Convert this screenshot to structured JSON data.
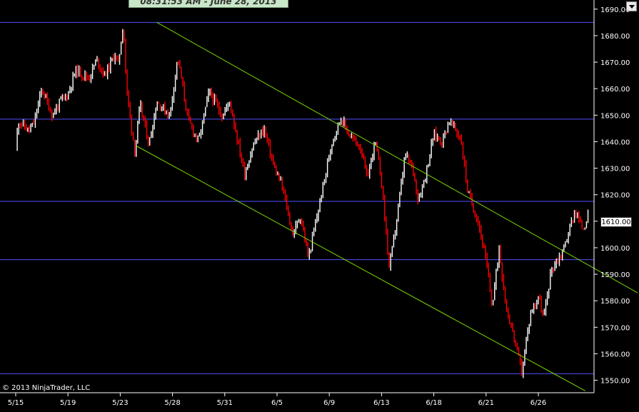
{
  "header": {
    "timestamp": "08:31:53 AM - June 28, 2013"
  },
  "footer": {
    "copyright": "© 2013 NinjaTrader, LLC"
  },
  "price_marker": {
    "label": "1610.00",
    "value": 1610
  },
  "colors": {
    "background": "#000000",
    "up_bar": "#ffffff",
    "down_bar": "#ff0000",
    "horizontal_lines": "#5050ff",
    "trend_channel": "#7cd600",
    "axis": "#ffffff"
  },
  "chart_data": {
    "type": "candlestick",
    "title": "",
    "xlabel": "",
    "ylabel": "",
    "ylim": [
      1546,
      1692
    ],
    "y_ticks": [
      1550,
      1560,
      1570,
      1580,
      1590,
      1600,
      1610,
      1620,
      1630,
      1640,
      1650,
      1660,
      1670,
      1680,
      1690
    ],
    "y_tick_labels": [
      "1550.00",
      "1560.00",
      "1570.00",
      "1580.00",
      "1590.00",
      "1600.00",
      "1610.00",
      "1620.00",
      "1630.00",
      "1640.00",
      "1650.00",
      "1660.00",
      "1670.00",
      "1680.00",
      "1690.00"
    ],
    "x_ticks": [
      "5/15",
      "5/19",
      "5/23",
      "5/28",
      "5/31",
      "6/5",
      "6/9",
      "6/13",
      "6/18",
      "6/21",
      "6/26"
    ],
    "grid": false,
    "horizontal_levels": [
      1685,
      1648.5,
      1617.5,
      1595.5,
      1552.5
    ],
    "trend_channel": [
      {
        "name": "upper",
        "from": {
          "x": 2.7,
          "y": 1685
        },
        "to": {
          "x": 11.9,
          "y": 1583
        }
      },
      {
        "name": "lower",
        "from": {
          "x": 2.3,
          "y": 1638.5
        },
        "to": {
          "x": 10.9,
          "y": 1546
        }
      }
    ],
    "price_path": [
      [
        0.0,
        1637
      ],
      [
        0.05,
        1648
      ],
      [
        0.25,
        1644
      ],
      [
        0.35,
        1647
      ],
      [
        0.5,
        1660
      ],
      [
        0.7,
        1650
      ],
      [
        0.85,
        1655
      ],
      [
        1.0,
        1658
      ],
      [
        1.15,
        1667
      ],
      [
        1.4,
        1664
      ],
      [
        1.55,
        1671
      ],
      [
        1.7,
        1665
      ],
      [
        1.9,
        1673
      ],
      [
        1.96,
        1669
      ],
      [
        2.06,
        1685
      ],
      [
        2.12,
        1660
      ],
      [
        2.28,
        1636
      ],
      [
        2.38,
        1654
      ],
      [
        2.55,
        1639
      ],
      [
        2.7,
        1655
      ],
      [
        2.95,
        1650
      ],
      [
        3.1,
        1672
      ],
      [
        3.3,
        1648
      ],
      [
        3.5,
        1640
      ],
      [
        3.7,
        1659
      ],
      [
        3.95,
        1650
      ],
      [
        4.1,
        1655
      ],
      [
        4.25,
        1640
      ],
      [
        4.38,
        1628
      ],
      [
        4.55,
        1639
      ],
      [
        4.75,
        1645
      ],
      [
        4.95,
        1630
      ],
      [
        5.1,
        1623
      ],
      [
        5.3,
        1605
      ],
      [
        5.45,
        1612
      ],
      [
        5.6,
        1596
      ],
      [
        5.85,
        1620
      ],
      [
        6.05,
        1640
      ],
      [
        6.22,
        1649
      ],
      [
        6.4,
        1642
      ],
      [
        6.6,
        1638
      ],
      [
        6.72,
        1626
      ],
      [
        6.88,
        1640
      ],
      [
        7.0,
        1625
      ],
      [
        7.15,
        1592
      ],
      [
        7.3,
        1612
      ],
      [
        7.45,
        1635
      ],
      [
        7.6,
        1630
      ],
      [
        7.7,
        1618
      ],
      [
        7.85,
        1628
      ],
      [
        8.0,
        1643
      ],
      [
        8.15,
        1640
      ],
      [
        8.3,
        1648
      ],
      [
        8.52,
        1641
      ],
      [
        8.65,
        1621
      ],
      [
        8.85,
        1610
      ],
      [
        9.0,
        1595
      ],
      [
        9.12,
        1578
      ],
      [
        9.25,
        1600
      ],
      [
        9.38,
        1578
      ],
      [
        9.55,
        1565
      ],
      [
        9.68,
        1553
      ],
      [
        9.85,
        1575
      ],
      [
        10.0,
        1582
      ],
      [
        10.1,
        1573
      ],
      [
        10.25,
        1592
      ],
      [
        10.45,
        1598
      ],
      [
        10.55,
        1604
      ],
      [
        10.7,
        1614
      ],
      [
        10.85,
        1607
      ],
      [
        10.95,
        1612
      ]
    ]
  }
}
